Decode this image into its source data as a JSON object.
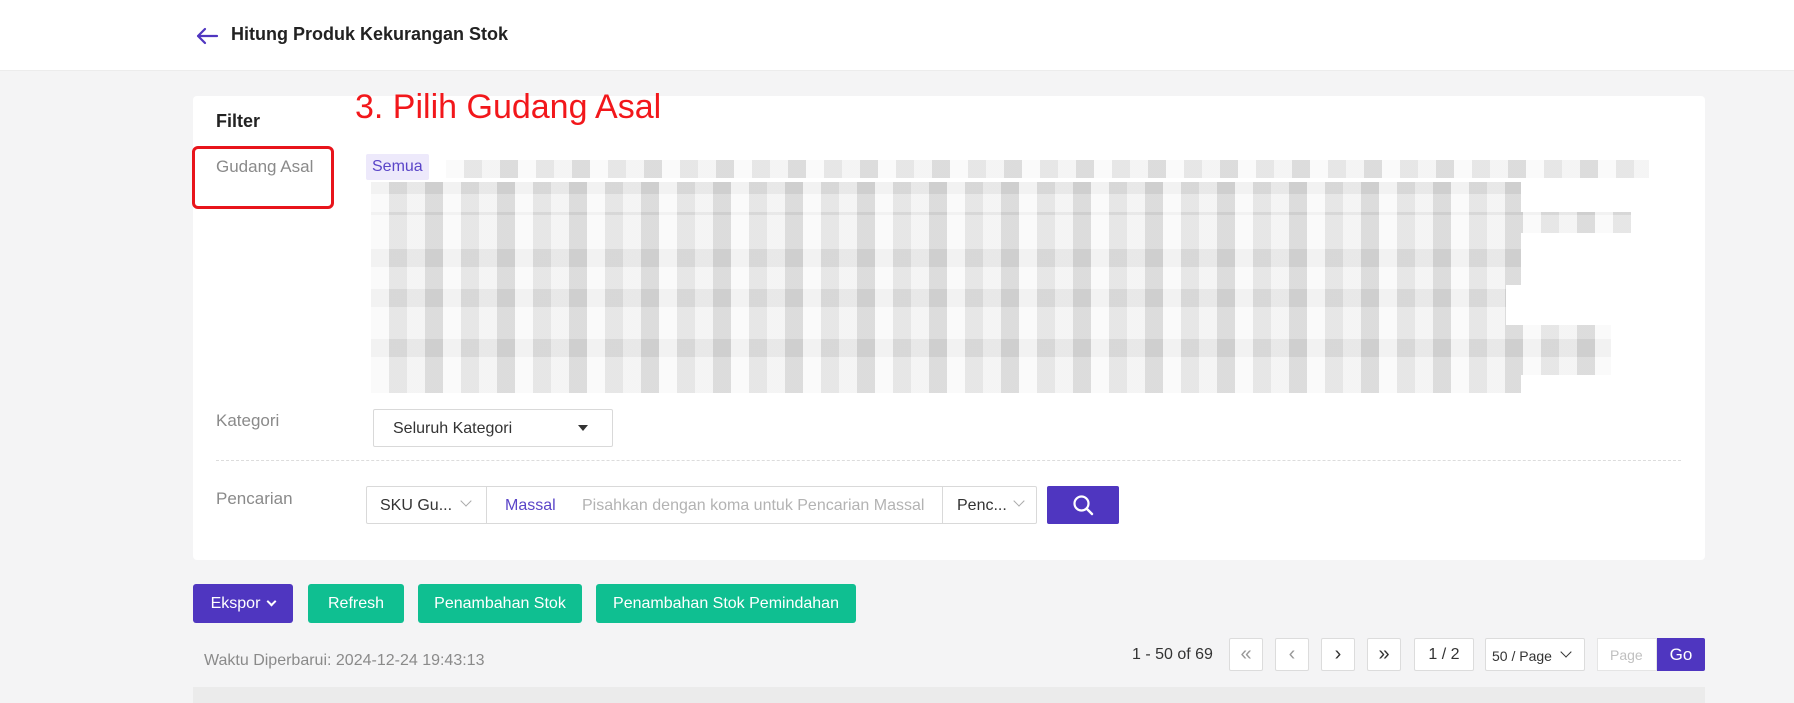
{
  "header": {
    "title": "Hitung Produk Kekurangan Stok",
    "back_icon": "arrow-left-icon"
  },
  "annotation": {
    "text": "3. Pilih Gudang Asal"
  },
  "filter": {
    "title": "Filter",
    "gudang_asal": {
      "label": "Gudang Asal",
      "selected": "Semua"
    },
    "kategori": {
      "label": "Kategori",
      "value": "Seluruh Kategori"
    },
    "pencarian": {
      "label": "Pencarian",
      "field_select": "SKU Gu...",
      "mode": "Massal",
      "placeholder": "Pisahkan dengan koma untuk Pencarian Massal",
      "match_select": "Penc..."
    }
  },
  "actions": {
    "export": "Ekspor",
    "refresh": "Refresh",
    "add_stock": "Penambahan Stok",
    "add_stock_transfer": "Penambahan Stok Pemindahan"
  },
  "status": {
    "updated": "Waktu Diperbarui: 2024-12-24 19:43:13"
  },
  "pagination": {
    "range": "1 - 50 of 69",
    "current": "1 / 2",
    "page_size": "50 / Page",
    "page_placeholder": "Page",
    "go": "Go"
  },
  "colors": {
    "primary": "#4f36c0",
    "success": "#0fbf91",
    "annotation": "#f2171b"
  }
}
